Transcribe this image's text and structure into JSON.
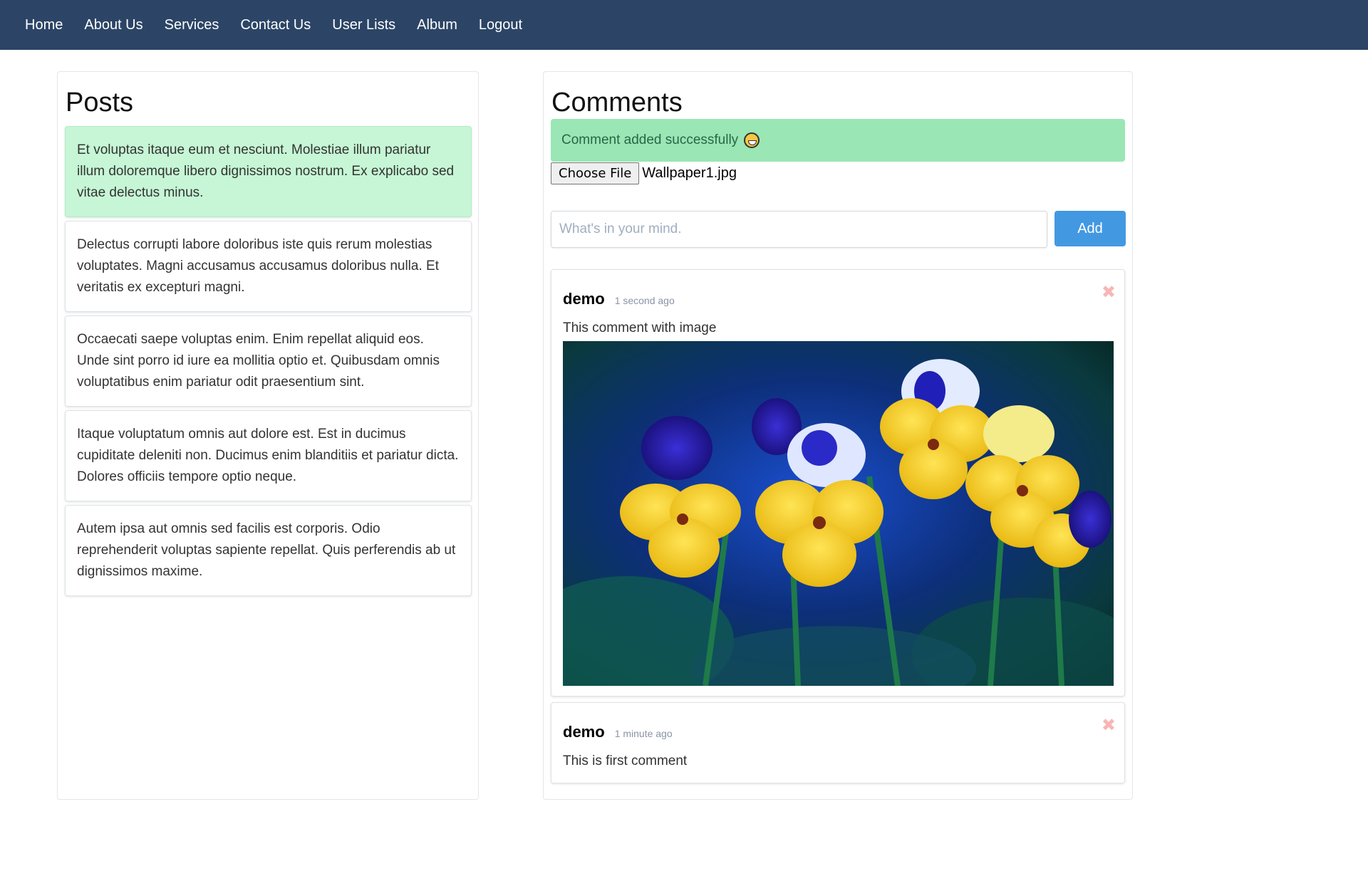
{
  "nav": {
    "items": [
      "Home",
      "About Us",
      "Services",
      "Contact Us",
      "User Lists",
      "Album",
      "Logout"
    ]
  },
  "posts": {
    "title": "Posts",
    "items": [
      {
        "text": "Et voluptas itaque eum et nesciunt. Molestiae illum pariatur illum doloremque libero dignissimos nostrum. Ex explicabo sed vitae delectus minus.",
        "active": true
      },
      {
        "text": "Delectus corrupti labore doloribus iste quis rerum molestias voluptates. Magni accusamus accusamus doloribus nulla. Et veritatis ex excepturi magni.",
        "active": false
      },
      {
        "text": "Occaecati saepe voluptas enim. Enim repellat aliquid eos. Unde sint porro id iure ea mollitia optio et. Quibusdam omnis voluptatibus enim pariatur odit praesentium sint.",
        "active": false
      },
      {
        "text": "Itaque voluptatum omnis aut dolore est. Est in ducimus cupiditate deleniti non. Ducimus enim blanditiis et pariatur dicta. Dolores officiis tempore optio neque.",
        "active": false
      },
      {
        "text": "Autem ipsa aut omnis sed facilis est corporis. Odio reprehenderit voluptas sapiente repellat. Quis perferendis ab ut dignissimos maxime.",
        "active": false
      }
    ]
  },
  "comments": {
    "title": "Comments",
    "alert": "Comment added successfully",
    "alert_icon": "grinning-emoji-icon",
    "file_button": "Choose File",
    "file_name": "Wallpaper1.jpg",
    "input_placeholder": "What's in your mind.",
    "input_value": "",
    "add_label": "Add",
    "close_glyph": "✖",
    "items": [
      {
        "author": "demo",
        "time": "1 second ago",
        "text": "This comment with image",
        "has_image": true
      },
      {
        "author": "demo",
        "time": "1 minute ago",
        "text": "This is first comment",
        "has_image": false
      }
    ]
  },
  "colors": {
    "navbar": "#2c4566",
    "active_post": "#c6f6d5",
    "alert_bg": "#9ae6b4",
    "alert_text": "#276749",
    "add_button": "#4299e1"
  }
}
